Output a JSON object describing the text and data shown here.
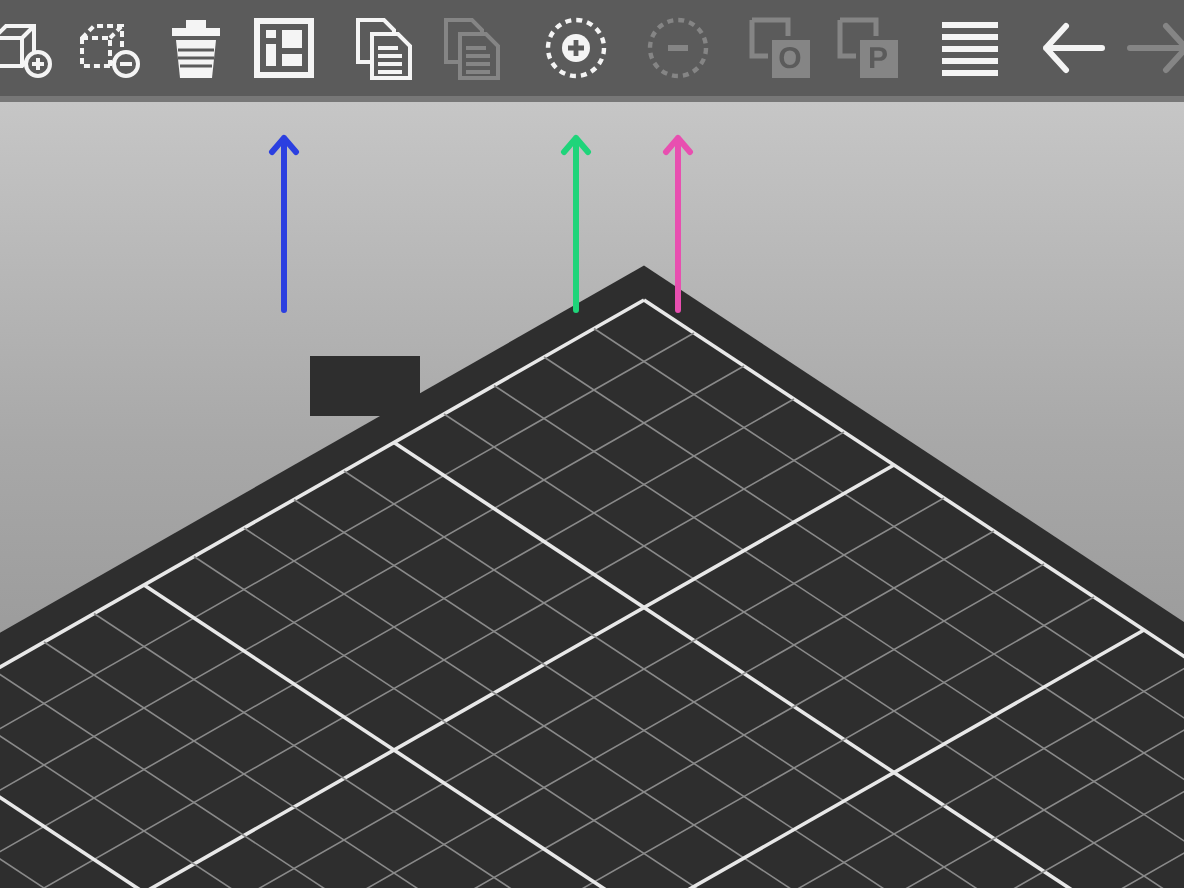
{
  "toolbar": {
    "tools": [
      {
        "kind": "add",
        "disabled": false
      },
      {
        "kind": "delete",
        "disabled": false
      },
      {
        "kind": "delete-all",
        "disabled": false
      },
      {
        "kind": "arrange",
        "disabled": false,
        "arrow": {
          "color": "#2b3fe0"
        }
      },
      {
        "kind": "copy",
        "disabled": false
      },
      {
        "kind": "paste",
        "disabled": true
      },
      {
        "kind": "add-instance",
        "disabled": false,
        "arrow": {
          "color": "#1fd47a"
        }
      },
      {
        "kind": "remove-instance",
        "disabled": true,
        "arrow": {
          "color": "#e84fb0"
        }
      },
      {
        "kind": "split-objects",
        "disabled": true,
        "label": "O"
      },
      {
        "kind": "split-parts",
        "disabled": true,
        "label": "P"
      },
      {
        "kind": "layers",
        "disabled": false
      },
      {
        "kind": "undo",
        "disabled": false
      },
      {
        "kind": "redo",
        "disabled": true
      }
    ]
  }
}
